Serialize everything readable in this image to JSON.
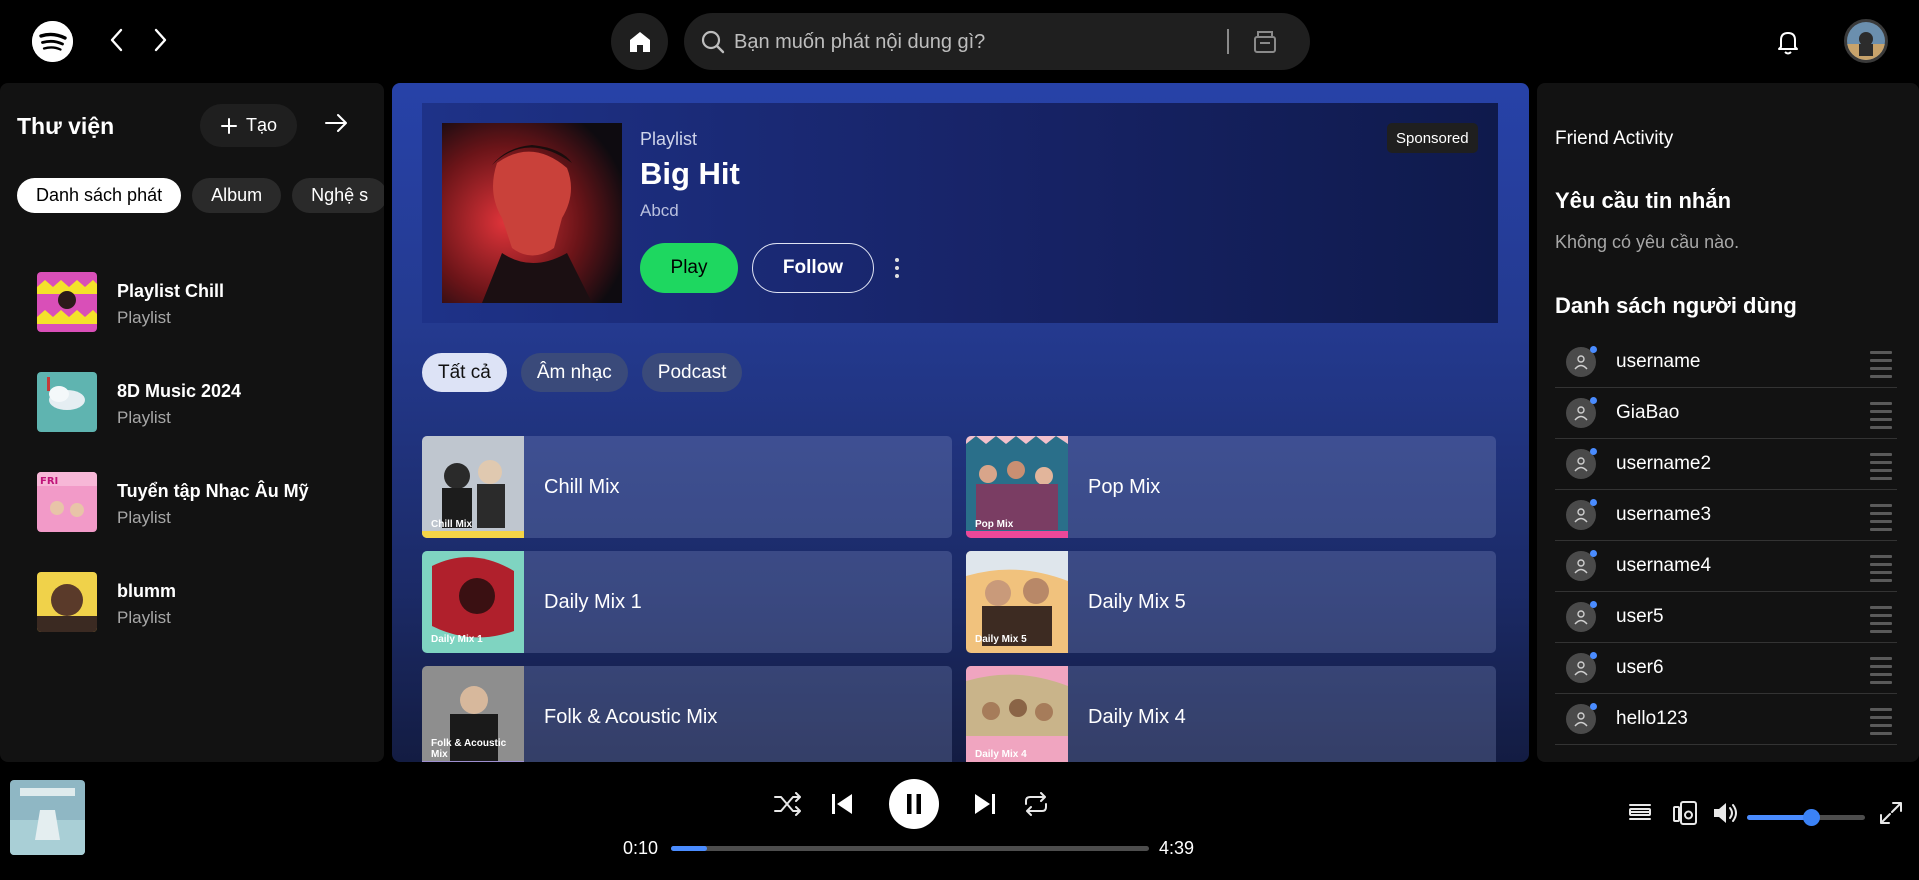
{
  "topbar": {
    "search_placeholder": "Bạn muốn phát nội dung gì?"
  },
  "library": {
    "title": "Thư viện",
    "create_label": "Tạo",
    "chips": [
      "Danh sách phát",
      "Album",
      "Nghệ s"
    ],
    "items": [
      {
        "name": "Playlist Chill",
        "sub": "Playlist"
      },
      {
        "name": "8D Music 2024",
        "sub": "Playlist"
      },
      {
        "name": "Tuyển tập Nhạc Âu Mỹ",
        "sub": "Playlist"
      },
      {
        "name": "blumm",
        "sub": "Playlist"
      }
    ]
  },
  "hero": {
    "type": "Playlist",
    "title": "Big Hit",
    "subtitle": "Abcd",
    "play_label": "Play",
    "follow_label": "Follow",
    "sponsored": "Sponsored"
  },
  "filters": [
    "Tất cả",
    "Âm nhạc",
    "Podcast"
  ],
  "mixes": [
    {
      "name": "Chill Mix",
      "caption": "Chill Mix",
      "color": "#f5d547"
    },
    {
      "name": "Pop Mix",
      "caption": "Pop Mix",
      "color": "#ec4899"
    },
    {
      "name": "Daily Mix 1",
      "caption": "Daily Mix 1",
      "color": "#7fd4c1"
    },
    {
      "name": "Daily Mix 5",
      "caption": "Daily Mix 5",
      "color": "#f1c27d"
    },
    {
      "name": "Folk & Acoustic Mix",
      "caption": "Folk & Acoustic Mix",
      "color": "#9e8fd0"
    },
    {
      "name": "Daily Mix 4",
      "caption": "Daily Mix 4",
      "color": "#f0a5c0"
    }
  ],
  "right_panel": {
    "friend_activity": "Friend Activity",
    "messages_title": "Yêu cầu tin nhắn",
    "messages_empty": "Không có yêu cầu nào.",
    "users_title": "Danh sách người dùng",
    "users": [
      "username",
      "GiaBao",
      "username2",
      "username3",
      "username4",
      "user5",
      "user6",
      "hello123"
    ]
  },
  "player": {
    "elapsed": "0:10",
    "duration": "4:39",
    "progress_percent": 7.5,
    "volume_percent": 55,
    "accent": "#4a8cff"
  }
}
